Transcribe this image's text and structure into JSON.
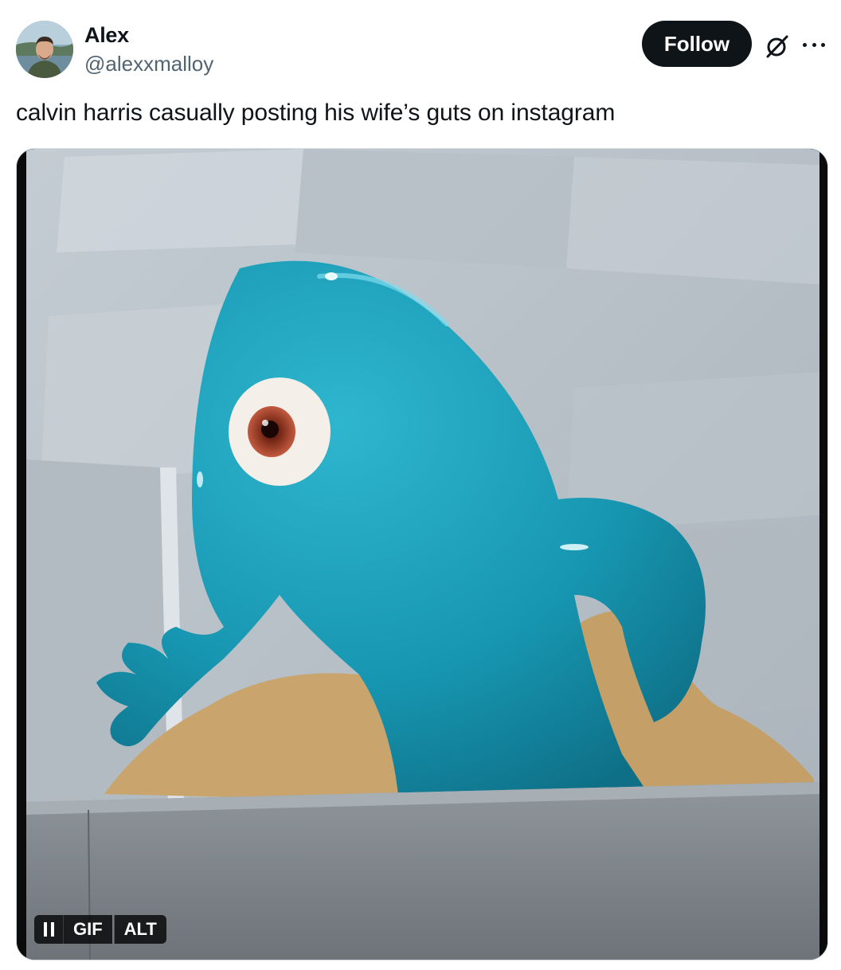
{
  "author": {
    "display_name": "Alex",
    "handle": "@alexxmalloy"
  },
  "actions": {
    "follow_label": "Follow",
    "grok_icon": "grok-icon",
    "more_icon": "more-dots-icon"
  },
  "tweet": {
    "text": "calvin harris casually posting his wife’s guts on instagram"
  },
  "media": {
    "type": "gif",
    "controls": {
      "pause_icon": "pause-icon",
      "gif_label": "GIF",
      "alt_label": "ALT"
    }
  },
  "colors": {
    "text_primary": "#0f1419",
    "text_secondary": "#536471",
    "follow_bg": "#0f1419",
    "blob": "#1b9bb5"
  }
}
